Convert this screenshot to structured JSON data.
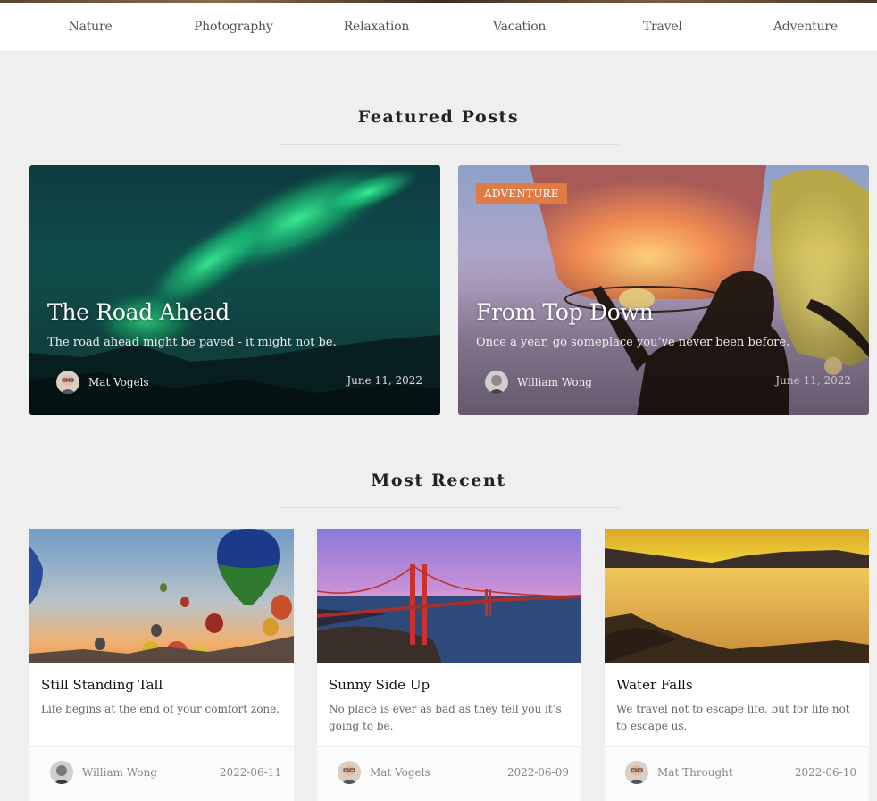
{
  "nav": {
    "items": [
      {
        "label": "Nature"
      },
      {
        "label": "Photography"
      },
      {
        "label": "Relaxation"
      },
      {
        "label": "Vacation"
      },
      {
        "label": "Travel"
      },
      {
        "label": "Adventure"
      }
    ]
  },
  "featured": {
    "heading": "Featured Posts",
    "posts": [
      {
        "title": "The Road Ahead",
        "excerpt": "The road ahead might be paved - it might not be.",
        "author": "Mat Vogels",
        "date": "June 11, 2022",
        "badge": ""
      },
      {
        "title": "From Top Down",
        "excerpt": "Once a year, go someplace you’ve never been before.",
        "author": "William Wong",
        "date": "June 11, 2022",
        "badge": "ADVENTURE"
      }
    ]
  },
  "recent": {
    "heading": "Most Recent",
    "posts": [
      {
        "title": "Still Standing Tall",
        "excerpt": "Life begins at the end of your comfort zone.",
        "author": "William Wong",
        "date": "2022-06-11"
      },
      {
        "title": "Sunny Side Up",
        "excerpt": "No place is ever as bad as they tell you it’s going to be.",
        "author": "Mat Vogels",
        "date": "2022-06-09"
      },
      {
        "title": "Water Falls",
        "excerpt": "We travel not to escape life, but for life not to escape us.",
        "author": "Mat Throught",
        "date": "2022-06-10"
      }
    ]
  },
  "colors": {
    "page_bg": "#efefef",
    "badge": "#e07b45",
    "nav_bg": "#ffffff"
  }
}
